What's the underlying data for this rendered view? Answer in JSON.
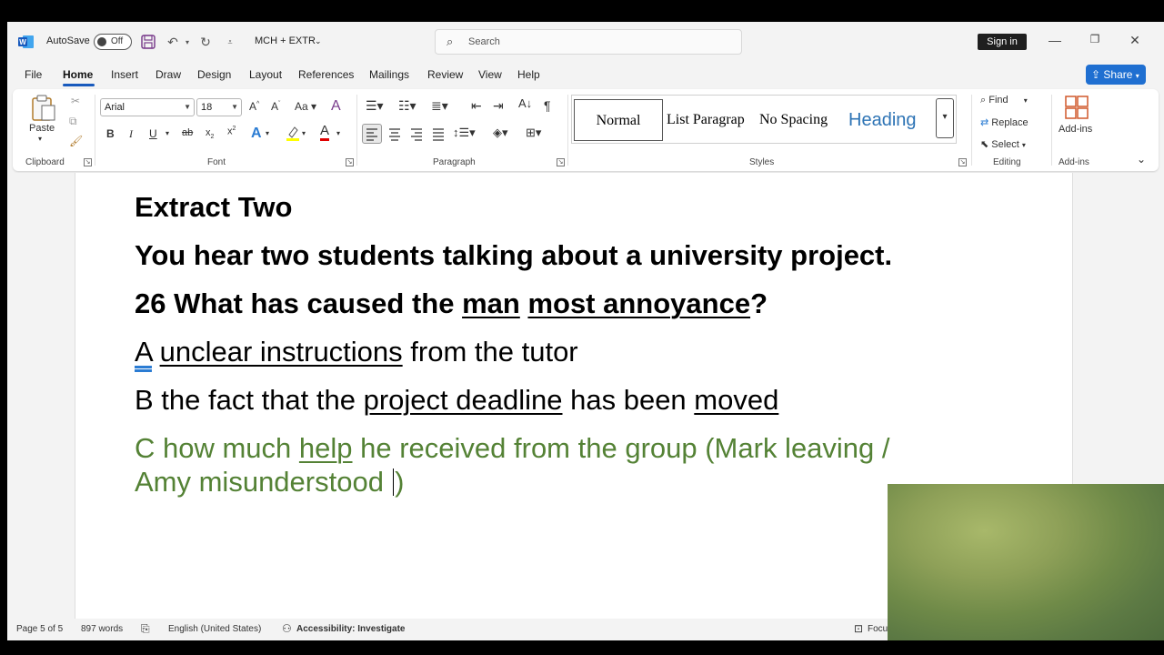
{
  "titlebar": {
    "autosave_label": "AutoSave",
    "autosave_state": "Off",
    "document_name": "MCH + EXTR",
    "search_placeholder": "Search",
    "signin_label": "Sign in"
  },
  "menu": {
    "items": [
      "File",
      "Home",
      "Insert",
      "Draw",
      "Design",
      "Layout",
      "References",
      "Mailings",
      "Review",
      "View",
      "Help"
    ],
    "active": "Home",
    "share_label": "Share"
  },
  "ribbon": {
    "clipboard": {
      "paste_label": "Paste",
      "group_label": "Clipboard"
    },
    "font": {
      "font_name": "Arial",
      "font_size": "18",
      "group_label": "Font"
    },
    "paragraph": {
      "group_label": "Paragraph"
    },
    "styles": {
      "items": [
        "Normal",
        "List Paragrap",
        "No Spacing",
        "Heading"
      ],
      "group_label": "Styles"
    },
    "editing": {
      "find_label": "Find",
      "replace_label": "Replace",
      "select_label": "Select",
      "group_label": "Editing"
    },
    "addins": {
      "label": "Add-ins",
      "group_label": "Add-ins"
    }
  },
  "document": {
    "heading": "Extract Two",
    "intro": "You hear two students talking about a university project.",
    "question": {
      "prefix": "26 What has caused the ",
      "u1": "man",
      "mid": " ",
      "u2": "most annoyance",
      "suffix": "?"
    },
    "option_a": {
      "letter": "A",
      "underlined": "unclear instructions",
      "rest": " from the tutor"
    },
    "option_b": {
      "prefix": "B the fact that the ",
      "u1": "project deadline",
      "mid": " has been ",
      "u2": "moved"
    },
    "option_c": {
      "prefix": "C how much ",
      "u1": "help",
      "rest": " he received from the group (Mark leaving  /",
      "line2": "Amy misunderstood ",
      "close": ")"
    },
    "colors": {
      "option_c": "#548235"
    }
  },
  "statusbar": {
    "page": "Page 5 of 5",
    "words": "897 words",
    "language": "English (United States)",
    "accessibility": "Accessibility: Investigate",
    "focus": "Focu"
  }
}
